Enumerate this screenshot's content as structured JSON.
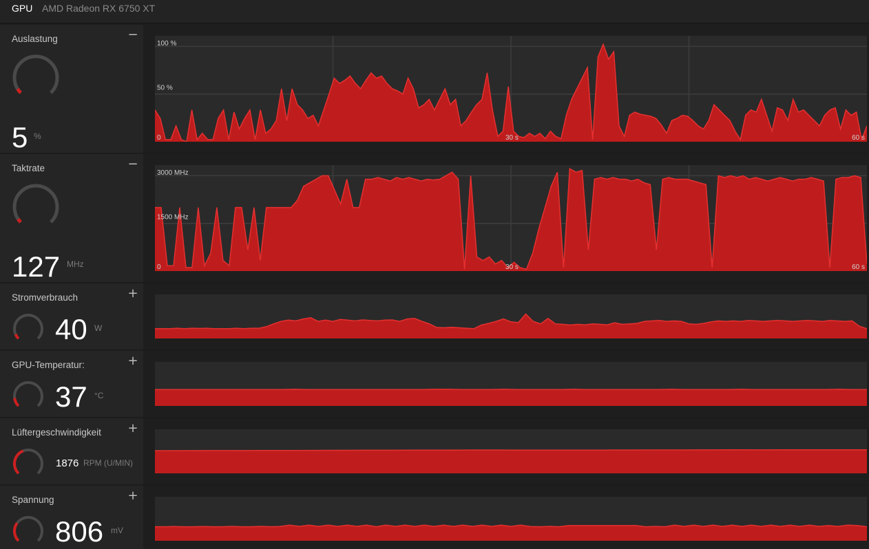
{
  "header": {
    "tab": "GPU",
    "model": "AMD Radeon RX 6750 XT"
  },
  "colors": {
    "accent": "#cc1f1f",
    "fill": "#bf1d1d",
    "line": "#e53030",
    "gauge_track": "#4a4a4a"
  },
  "panels": [
    {
      "key": "util",
      "title": "Auslastung",
      "toggle": "−",
      "value": "5",
      "unit": "%",
      "gauge_fraction": 0.05,
      "axis": {
        "top": "100 %",
        "mid": "50 %",
        "zero": "0",
        "t30": "30 s",
        "t60": "60 s"
      },
      "max": 100,
      "series": [
        30,
        22,
        2,
        2,
        15,
        2,
        0,
        30,
        2,
        8,
        2,
        2,
        22,
        30,
        2,
        28,
        12,
        22,
        30,
        2,
        30,
        8,
        12,
        20,
        50,
        20,
        50,
        35,
        30,
        22,
        25,
        15,
        30,
        45,
        60,
        55,
        58,
        62,
        55,
        50,
        58,
        65,
        60,
        62,
        55,
        50,
        48,
        45,
        60,
        50,
        32,
        35,
        40,
        30,
        40,
        50,
        35,
        40,
        15,
        20,
        28,
        35,
        40,
        65,
        30,
        5,
        10,
        52,
        10,
        5,
        4,
        8,
        5,
        8,
        3,
        10,
        5,
        3,
        25,
        40,
        50,
        60,
        70,
        2,
        80,
        92,
        78,
        85,
        15,
        5,
        25,
        28,
        26,
        25,
        24,
        22,
        16,
        8,
        20,
        22,
        25,
        24,
        20,
        15,
        12,
        20,
        35,
        30,
        25,
        20,
        10,
        2,
        25,
        30,
        28,
        40,
        25,
        10,
        32,
        30,
        20,
        40,
        28,
        30,
        25,
        20,
        15,
        25,
        30,
        32,
        12,
        30,
        25,
        28,
        2,
        15
      ],
      "vlines": [
        0.25,
        0.5,
        0.75
      ],
      "hlines": [
        0.55,
        0.1
      ]
    },
    {
      "key": "clock",
      "title": "Taktrate",
      "toggle": "−",
      "value": "127",
      "unit": "MHz",
      "gauge_fraction": 0.04,
      "axis": {
        "top": "3000 MHz",
        "mid": "1500 MHz",
        "zero": "0",
        "t30": "30 s",
        "t60": "60 s"
      },
      "max": 3000,
      "series": [
        1800,
        1800,
        150,
        150,
        1800,
        100,
        100,
        1800,
        150,
        500,
        1800,
        300,
        150,
        1800,
        1800,
        600,
        1800,
        300,
        1800,
        1800,
        1800,
        1800,
        1800,
        2000,
        2400,
        2500,
        2600,
        2700,
        2700,
        2300,
        1900,
        2600,
        1800,
        1800,
        2600,
        2600,
        2650,
        2600,
        2550,
        2650,
        2600,
        2650,
        2600,
        2550,
        2600,
        2580,
        2600,
        2700,
        2800,
        2600,
        50,
        2700,
        400,
        300,
        400,
        200,
        300,
        100,
        250,
        100,
        50,
        500,
        1200,
        1800,
        2400,
        2800,
        100,
        2900,
        2800,
        2850,
        600,
        2600,
        2650,
        2600,
        2650,
        2600,
        2600,
        2550,
        2600,
        2500,
        2450,
        600,
        2600,
        2650,
        2600,
        2600,
        2600,
        2550,
        2500,
        2450,
        100,
        2700,
        2650,
        2700,
        2650,
        2700,
        2600,
        2650,
        2600,
        2550,
        2600,
        2650,
        2600,
        2550,
        2600,
        2600,
        2650,
        2600,
        2550,
        100,
        2600,
        2650,
        2650,
        2700,
        2650,
        200
      ],
      "vlines": [
        0.25,
        0.5,
        0.75
      ],
      "hlines": [
        0.55,
        0.1
      ]
    },
    {
      "key": "power",
      "title": "Stromverbrauch",
      "toggle": "+",
      "value": "40",
      "unit": "W",
      "gauge_fraction": 0.08,
      "max": 180,
      "series": [
        40,
        40,
        40,
        42,
        40,
        42,
        41,
        42,
        40,
        40,
        40,
        42,
        40,
        42,
        42,
        48,
        60,
        70,
        75,
        72,
        80,
        85,
        70,
        75,
        70,
        78,
        75,
        72,
        76,
        74,
        72,
        75,
        76,
        70,
        80,
        82,
        70,
        60,
        45,
        44,
        46,
        44,
        42,
        40,
        55,
        62,
        70,
        80,
        68,
        65,
        100,
        70,
        60,
        82,
        60,
        58,
        55,
        58,
        56,
        60,
        58,
        56,
        64,
        58,
        60,
        62,
        70,
        72,
        74,
        70,
        72,
        70,
        60,
        58,
        62,
        68,
        72,
        70,
        72,
        70,
        74,
        72,
        70,
        72,
        74,
        72,
        70,
        72,
        74,
        72,
        70,
        74,
        72,
        70,
        72,
        50,
        40
      ],
      "vlines": [],
      "hlines": []
    },
    {
      "key": "temp",
      "title": "GPU-Temperatur:",
      "toggle": "+",
      "value": "37",
      "unit": "°C",
      "gauge_fraction": 0.14,
      "max": 100,
      "series": [
        37,
        37,
        37,
        37,
        37,
        37,
        37,
        37,
        37,
        37,
        38,
        37,
        37,
        37,
        37,
        37,
        37,
        37,
        37,
        37,
        38,
        38,
        37,
        37,
        37,
        38,
        37,
        37,
        37,
        37,
        38,
        37,
        37,
        37,
        37,
        37,
        37,
        38,
        37,
        37,
        37,
        37,
        38,
        37,
        37,
        37,
        37,
        37,
        37,
        38,
        37,
        37
      ],
      "vlines": [],
      "hlines": []
    },
    {
      "key": "fan",
      "title": "Lüftergeschwindigkeit",
      "toggle": "+",
      "value": "1876",
      "unit": "RPM (U/MIN)",
      "gauge_fraction": 0.42,
      "max": 3500,
      "series": [
        1800,
        1805,
        1810,
        1812,
        1815,
        1820,
        1825,
        1830,
        1835,
        1840,
        1845,
        1850,
        1852,
        1855,
        1850,
        1848,
        1845,
        1850,
        1855,
        1860,
        1862,
        1865,
        1868,
        1866,
        1870,
        1872,
        1874,
        1876
      ],
      "vlines": [],
      "hlines": []
    },
    {
      "key": "voltage",
      "title": "Spannung",
      "toggle": "+",
      "value": "806",
      "unit": "mV",
      "gauge_fraction": 0.3,
      "max": 2200,
      "series": [
        700,
        700,
        710,
        700,
        700,
        710,
        700,
        700,
        720,
        700,
        700,
        720,
        700,
        710,
        780,
        720,
        780,
        720,
        780,
        720,
        780,
        720,
        780,
        700,
        780,
        720,
        780,
        720,
        780,
        720,
        780,
        720,
        780,
        720,
        780,
        720,
        780,
        720,
        780,
        710,
        700,
        720,
        700,
        760,
        760,
        760,
        760,
        760,
        760,
        760,
        760,
        700,
        720,
        700,
        780,
        720,
        780,
        720,
        780,
        720,
        780,
        720,
        780,
        720,
        780,
        720,
        780,
        720,
        780,
        720,
        760,
        720,
        780,
        760,
        700
      ],
      "vlines": [],
      "hlines": []
    }
  ]
}
